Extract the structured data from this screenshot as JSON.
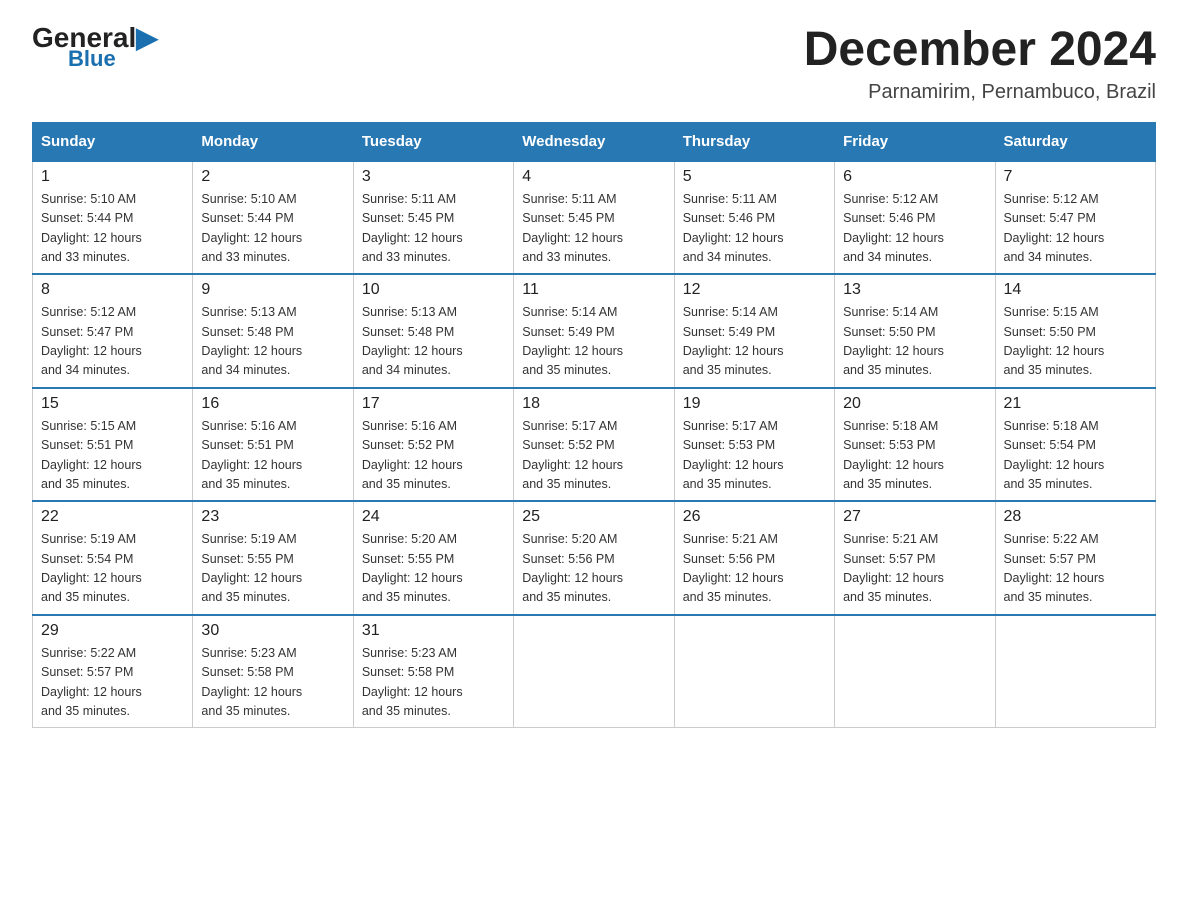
{
  "logo": {
    "general": "General",
    "blue": "Blue"
  },
  "header": {
    "title": "December 2024",
    "subtitle": "Parnamirim, Pernambuco, Brazil"
  },
  "days_of_week": [
    "Sunday",
    "Monday",
    "Tuesday",
    "Wednesday",
    "Thursday",
    "Friday",
    "Saturday"
  ],
  "weeks": [
    [
      {
        "day": "1",
        "sunrise": "5:10 AM",
        "sunset": "5:44 PM",
        "daylight": "12 hours and 33 minutes."
      },
      {
        "day": "2",
        "sunrise": "5:10 AM",
        "sunset": "5:44 PM",
        "daylight": "12 hours and 33 minutes."
      },
      {
        "day": "3",
        "sunrise": "5:11 AM",
        "sunset": "5:45 PM",
        "daylight": "12 hours and 33 minutes."
      },
      {
        "day": "4",
        "sunrise": "5:11 AM",
        "sunset": "5:45 PM",
        "daylight": "12 hours and 33 minutes."
      },
      {
        "day": "5",
        "sunrise": "5:11 AM",
        "sunset": "5:46 PM",
        "daylight": "12 hours and 34 minutes."
      },
      {
        "day": "6",
        "sunrise": "5:12 AM",
        "sunset": "5:46 PM",
        "daylight": "12 hours and 34 minutes."
      },
      {
        "day": "7",
        "sunrise": "5:12 AM",
        "sunset": "5:47 PM",
        "daylight": "12 hours and 34 minutes."
      }
    ],
    [
      {
        "day": "8",
        "sunrise": "5:12 AM",
        "sunset": "5:47 PM",
        "daylight": "12 hours and 34 minutes."
      },
      {
        "day": "9",
        "sunrise": "5:13 AM",
        "sunset": "5:48 PM",
        "daylight": "12 hours and 34 minutes."
      },
      {
        "day": "10",
        "sunrise": "5:13 AM",
        "sunset": "5:48 PM",
        "daylight": "12 hours and 34 minutes."
      },
      {
        "day": "11",
        "sunrise": "5:14 AM",
        "sunset": "5:49 PM",
        "daylight": "12 hours and 35 minutes."
      },
      {
        "day": "12",
        "sunrise": "5:14 AM",
        "sunset": "5:49 PM",
        "daylight": "12 hours and 35 minutes."
      },
      {
        "day": "13",
        "sunrise": "5:14 AM",
        "sunset": "5:50 PM",
        "daylight": "12 hours and 35 minutes."
      },
      {
        "day": "14",
        "sunrise": "5:15 AM",
        "sunset": "5:50 PM",
        "daylight": "12 hours and 35 minutes."
      }
    ],
    [
      {
        "day": "15",
        "sunrise": "5:15 AM",
        "sunset": "5:51 PM",
        "daylight": "12 hours and 35 minutes."
      },
      {
        "day": "16",
        "sunrise": "5:16 AM",
        "sunset": "5:51 PM",
        "daylight": "12 hours and 35 minutes."
      },
      {
        "day": "17",
        "sunrise": "5:16 AM",
        "sunset": "5:52 PM",
        "daylight": "12 hours and 35 minutes."
      },
      {
        "day": "18",
        "sunrise": "5:17 AM",
        "sunset": "5:52 PM",
        "daylight": "12 hours and 35 minutes."
      },
      {
        "day": "19",
        "sunrise": "5:17 AM",
        "sunset": "5:53 PM",
        "daylight": "12 hours and 35 minutes."
      },
      {
        "day": "20",
        "sunrise": "5:18 AM",
        "sunset": "5:53 PM",
        "daylight": "12 hours and 35 minutes."
      },
      {
        "day": "21",
        "sunrise": "5:18 AM",
        "sunset": "5:54 PM",
        "daylight": "12 hours and 35 minutes."
      }
    ],
    [
      {
        "day": "22",
        "sunrise": "5:19 AM",
        "sunset": "5:54 PM",
        "daylight": "12 hours and 35 minutes."
      },
      {
        "day": "23",
        "sunrise": "5:19 AM",
        "sunset": "5:55 PM",
        "daylight": "12 hours and 35 minutes."
      },
      {
        "day": "24",
        "sunrise": "5:20 AM",
        "sunset": "5:55 PM",
        "daylight": "12 hours and 35 minutes."
      },
      {
        "day": "25",
        "sunrise": "5:20 AM",
        "sunset": "5:56 PM",
        "daylight": "12 hours and 35 minutes."
      },
      {
        "day": "26",
        "sunrise": "5:21 AM",
        "sunset": "5:56 PM",
        "daylight": "12 hours and 35 minutes."
      },
      {
        "day": "27",
        "sunrise": "5:21 AM",
        "sunset": "5:57 PM",
        "daylight": "12 hours and 35 minutes."
      },
      {
        "day": "28",
        "sunrise": "5:22 AM",
        "sunset": "5:57 PM",
        "daylight": "12 hours and 35 minutes."
      }
    ],
    [
      {
        "day": "29",
        "sunrise": "5:22 AM",
        "sunset": "5:57 PM",
        "daylight": "12 hours and 35 minutes."
      },
      {
        "day": "30",
        "sunrise": "5:23 AM",
        "sunset": "5:58 PM",
        "daylight": "12 hours and 35 minutes."
      },
      {
        "day": "31",
        "sunrise": "5:23 AM",
        "sunset": "5:58 PM",
        "daylight": "12 hours and 35 minutes."
      },
      null,
      null,
      null,
      null
    ]
  ],
  "labels": {
    "sunrise": "Sunrise:",
    "sunset": "Sunset:",
    "daylight": "Daylight:"
  }
}
